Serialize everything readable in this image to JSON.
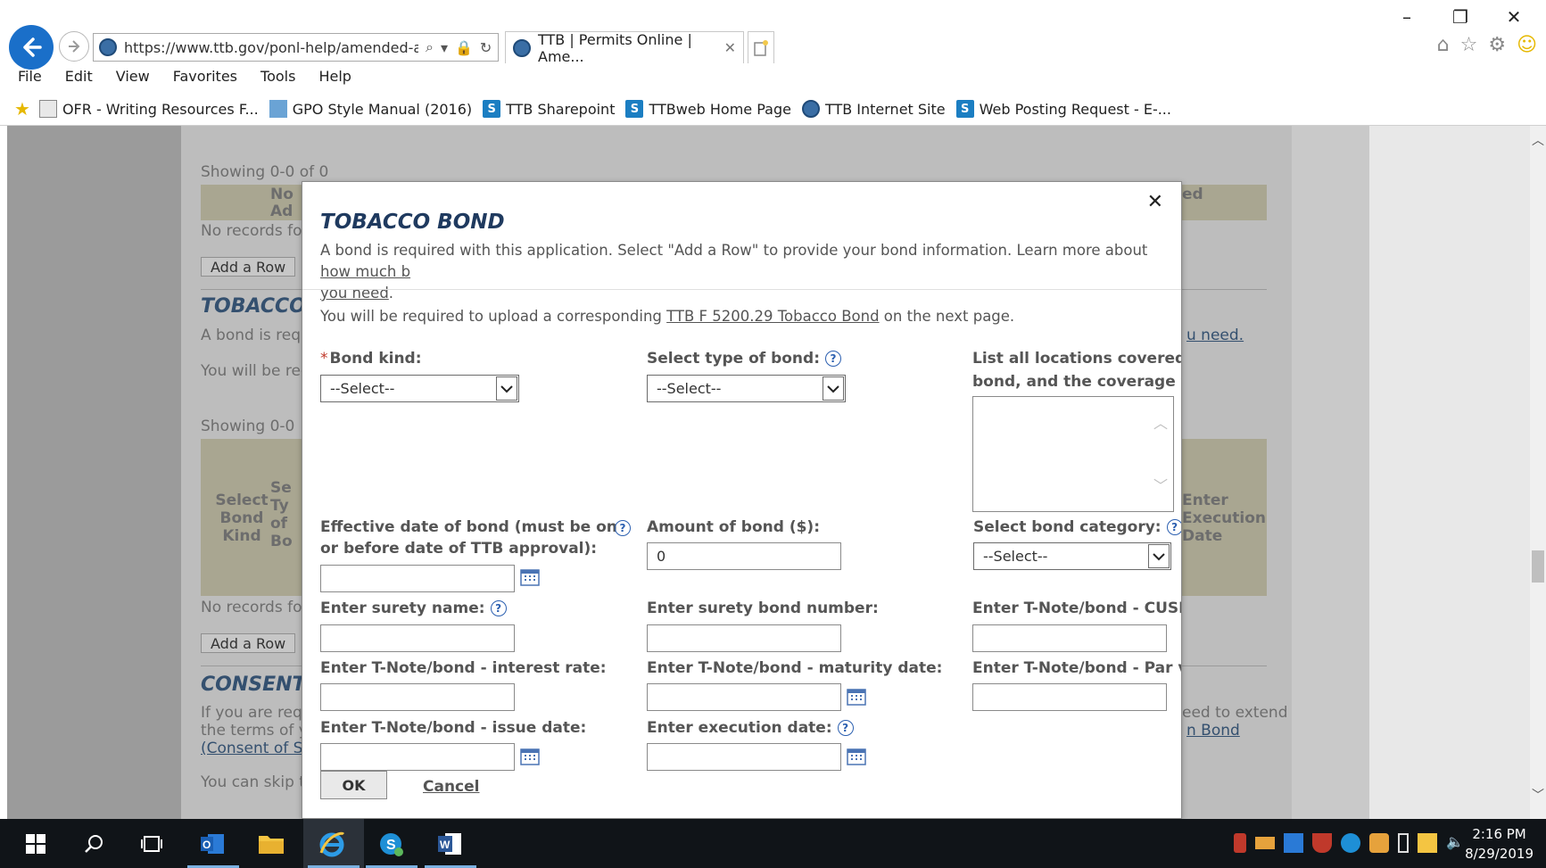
{
  "browser": {
    "url": "https://www.ttb.gov/ponl-help/amended-app",
    "tab_title": "TTB | Permits Online | Ame...",
    "menu": [
      "File",
      "Edit",
      "View",
      "Favorites",
      "Tools",
      "Help"
    ],
    "favorites": [
      {
        "label": "OFR - Writing Resources F...",
        "icon": "doc-icon"
      },
      {
        "label": "GPO Style Manual (2016)",
        "icon": "gpo-icon"
      },
      {
        "label": "TTB Sharepoint",
        "icon": "sharepoint-icon"
      },
      {
        "label": "TTBweb Home Page",
        "icon": "sharepoint-icon"
      },
      {
        "label": "TTB Internet Site",
        "icon": "shield-icon"
      },
      {
        "label": "Web Posting Request - E-...",
        "icon": "sharepoint-icon"
      }
    ]
  },
  "background_page": {
    "showing_top": "Showing 0-0 of 0",
    "col_no": "No",
    "col_ad": "Ad",
    "col_ed": "ed",
    "no_records_1": "No records fo",
    "add_row_1": "Add a Row",
    "tobacco_heading": "TOBACCO",
    "bond_req": "A bond is requ",
    "you_will": "You will be req",
    "u_need": "u need.",
    "showing_mid": "Showing 0-0",
    "col_select_bond_kind": "Select Bond Kind",
    "col_se": "Se Ty of Bo",
    "col_enter_exec": "Enter Execution Date",
    "no_records_2": "No records fo",
    "add_row_2": "Add a Row",
    "consent_heading": "CONSENT",
    "consent_line1": "If you are requ",
    "consent_line2": "the terms of yo",
    "consent_line3": "(Consent of Su",
    "consent_right1": "eed to extend",
    "consent_right2": "n Bond",
    "skip_line": "You can skip t"
  },
  "modal": {
    "title": "TOBACCO BOND",
    "close": "✕",
    "intro_text": "A bond is required with this application. Select \"Add a Row\" to provide your bond information. Learn more about ",
    "intro_link": "how much b",
    "intro_link2": "you need",
    "intro_end": ".",
    "upload_pre": "You will be required to upload a corresponding ",
    "upload_link": "TTB F 5200.29 Tobacco Bond",
    "upload_post": " on the next page.",
    "bond_kind_label": "Bond kind:",
    "bond_kind_value": "--Select--",
    "bond_type_label": "Select type of bond:",
    "bond_type_value": "--Select--",
    "locations_label_1": "List all locations covered u",
    "locations_label_2": "bond, and the coverage fo",
    "effective_label_1": "Effective date of bond (must be on",
    "effective_label_2": "or before date of TTB approval):",
    "effective_value": "",
    "amount_label": "Amount of bond ($):",
    "amount_value": "0",
    "category_label": "Select bond category:",
    "category_value": "--Select--",
    "surety_name_label": "Enter surety name:",
    "surety_number_label": "Enter surety bond number:",
    "cusip_label": "Enter T-Note/bond - CUSIP",
    "interest_label": "Enter T-Note/bond - interest rate:",
    "maturity_label": "Enter T-Note/bond - maturity date:",
    "par_label": "Enter T-Note/bond - Par va",
    "issue_label": "Enter T-Note/bond - issue date:",
    "execution_label": "Enter execution date:",
    "ok": "OK",
    "cancel": "Cancel"
  },
  "taskbar": {
    "time": "2:16 PM",
    "date": "8/29/2019"
  }
}
